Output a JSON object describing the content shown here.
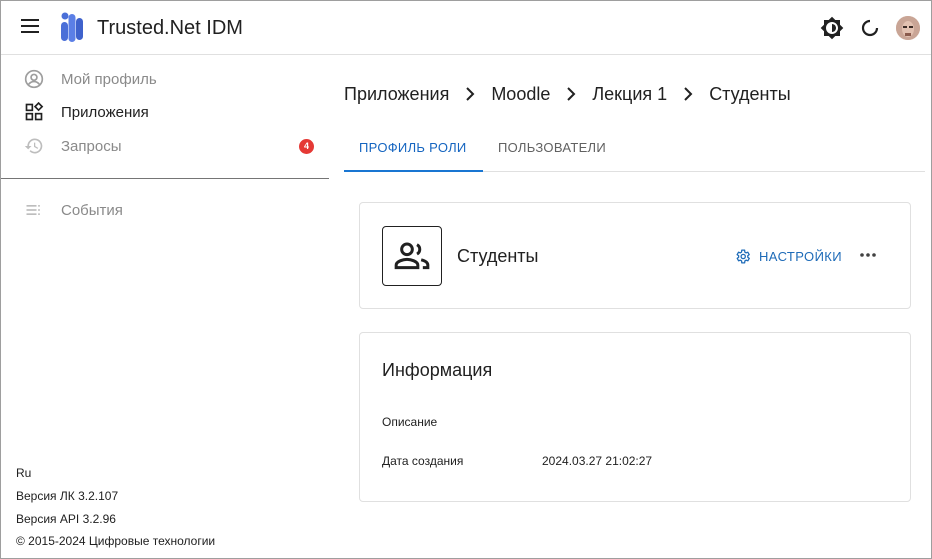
{
  "header": {
    "app_title": "Trusted.Net IDM",
    "icons": [
      "menu-icon",
      "app-logo",
      "brightness-icon",
      "refresh-icon",
      "avatar"
    ]
  },
  "sidebar": {
    "items": [
      {
        "label": "Мой профиль",
        "icon": "account-circle-icon",
        "muted": true
      },
      {
        "label": "Приложения",
        "icon": "apps-icon",
        "muted": false
      },
      {
        "label": "Запросы",
        "icon": "history-icon",
        "muted": true,
        "badge": "4"
      },
      {
        "label": "События",
        "icon": "list-icon",
        "muted": true
      }
    ],
    "footer": {
      "language": "Ru",
      "version_lk": "Версия ЛК 3.2.107",
      "version_api": "Версия API 3.2.96",
      "copyright": "© 2015-2024 Цифровые технологии"
    }
  },
  "breadcrumb": [
    "Приложения",
    "Moodle",
    "Лекция 1",
    "Студенты"
  ],
  "tabs": [
    {
      "label": "ПРОФИЛЬ РОЛИ",
      "active": true
    },
    {
      "label": "ПОЛЬЗОВАТЕЛИ",
      "active": false
    }
  ],
  "role_card": {
    "title": "Студенты",
    "settings_label": "НАСТРОЙКИ",
    "icon": "group-icon"
  },
  "info_card": {
    "title": "Информация",
    "rows": [
      {
        "label": "Описание",
        "value": ""
      },
      {
        "label": "Дата создания",
        "value": "2024.03.27 21:02:27"
      }
    ]
  },
  "colors": {
    "accent": "#1976d2",
    "badge": "#e53935",
    "logo": "#4a6fd8"
  }
}
